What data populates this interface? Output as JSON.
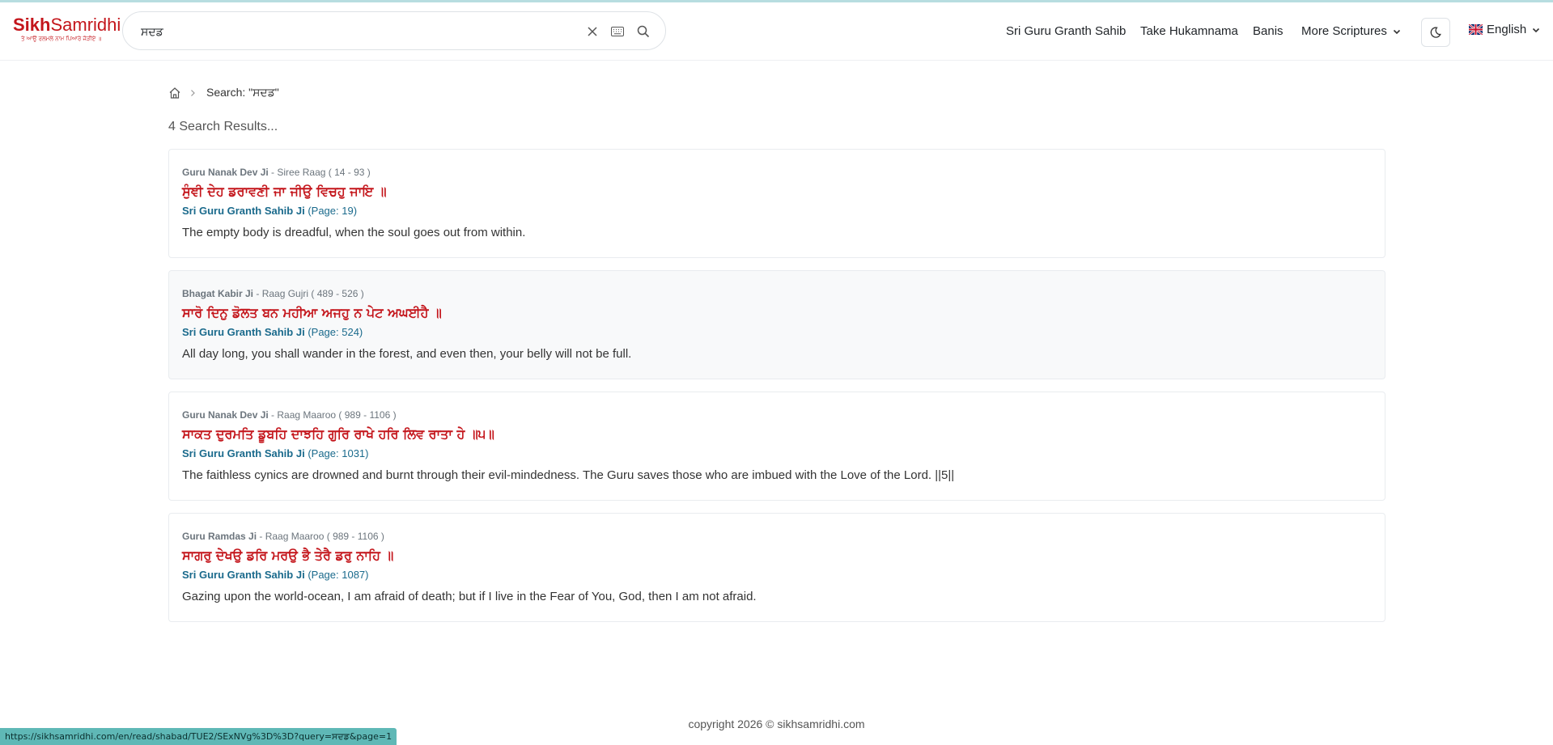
{
  "logo": {
    "part1": "Sikh",
    "part2": "Samridhi",
    "tagline": "ਤੇ ਆਉ ਰਲਮਲੇ ਨਾਮ ਪਿਆਰੇ ਜੋੜੀਏ ॥"
  },
  "search": {
    "value": "ਸਦਡ",
    "placeholder": ""
  },
  "nav": {
    "items": [
      "Sri Guru Granth Sahib",
      "Take Hukamnama",
      "Banis",
      "More Scriptures"
    ],
    "language": "English"
  },
  "breadcrumb": {
    "current": "Search: \"ਸਦਡ\""
  },
  "results_count": "4 Search Results...",
  "results": [
    {
      "author": "Guru Nanak Dev Ji",
      "raag": " - Siree Raag ( 14 - 93 )",
      "gurbani": "ਸੁੰਞੀ ਦੇਹ ਡਰਾਵਣੀ ਜਾ ਜੀਉ ਵਿਚਹੁ ਜਾਇ ॥",
      "source": "Sri Guru Granth Sahib Ji",
      "page": " (Page: 19)",
      "translation": "The empty body is dreadful, when the soul goes out from within."
    },
    {
      "author": "Bhagat Kabir Ji",
      "raag": " - Raag Gujri ( 489 - 526 )",
      "gurbani": "ਸਾਰੋ ਦਿਨੁ ਡੋਲਤ ਬਨ ਮਹੀਆ ਅਜਹੁ ਨ ਪੇਟ ਅਘਈਹੈ ॥",
      "source": "Sri Guru Granth Sahib Ji",
      "page": " (Page: 524)",
      "translation": "All day long, you shall wander in the forest, and even then, your belly will not be full."
    },
    {
      "author": "Guru Nanak Dev Ji",
      "raag": " - Raag Maaroo ( 989 - 1106 )",
      "gurbani": "ਸਾਕਤ ਦੁਰਮਤਿ ਡੂਬਹਿ ਦਾਝਹਿ ਗੁਰਿ ਰਾਖੇ ਹਰਿ ਲਿਵ ਰਾਤਾ ਹੇ ॥੫॥",
      "source": "Sri Guru Granth Sahib Ji",
      "page": " (Page: 1031)",
      "translation": "The faithless cynics are drowned and burnt through their evil-mindedness. The Guru saves those who are imbued with the Love of the Lord. ||5||"
    },
    {
      "author": "Guru Ramdas Ji",
      "raag": " - Raag Maaroo ( 989 - 1106 )",
      "gurbani": "ਸਾਗਰੁ ਦੇਖਉ ਡਰਿ ਮਰਉ ਭੈ ਤੇਰੈ ਡਰੁ ਨਾਹਿ ॥",
      "source": "Sri Guru Granth Sahib Ji",
      "page": " (Page: 1087)",
      "translation": "Gazing upon the world-ocean, I am afraid of death; but if I live in the Fear of You, God, then I am not afraid."
    }
  ],
  "footer": {
    "copyright": "copyright 2026 © sikhsamridhi.com"
  },
  "status_url": "https://sikhsamridhi.com/en/read/shabad/TUE2/SExNVg%3D%3D?query=ਸਦਡ&page=1",
  "colors": {
    "brand_red": "#c4161c",
    "link_blue": "#1a6a8c",
    "status_bar": "#5fb8b6"
  }
}
